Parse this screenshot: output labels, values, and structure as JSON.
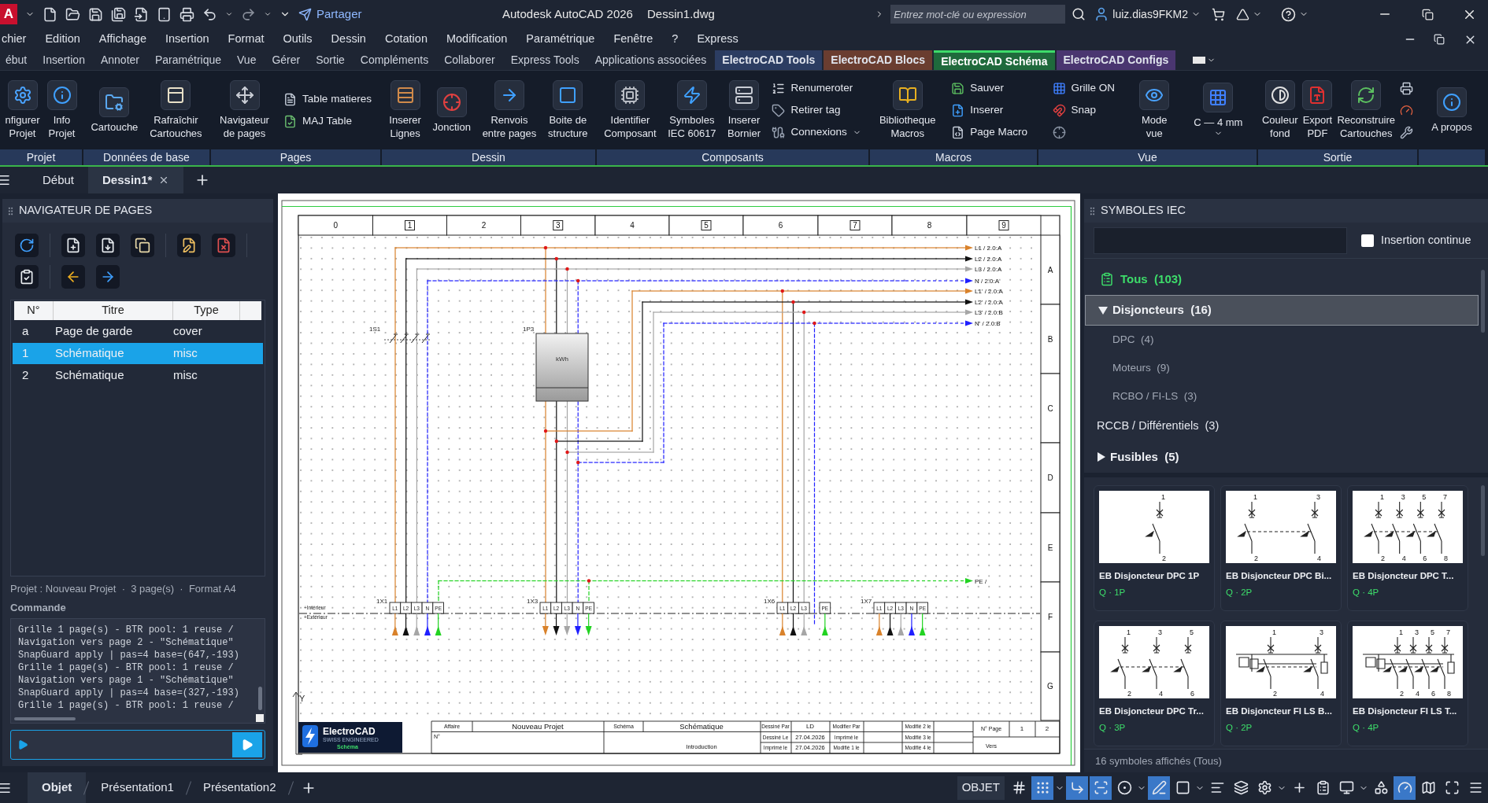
{
  "title_bar": {
    "logo": "A",
    "share": "Partager",
    "app_title": "Autodesk AutoCAD 2026",
    "file": "Dessin1.dwg",
    "search": {
      "placeholder": "Entrez mot-clé ou expression"
    },
    "user": "luiz.dias9FKM2"
  },
  "menu": [
    "chier",
    "Edition",
    "Affichage",
    "Insertion",
    "Format",
    "Outils",
    "Dessin",
    "Cotation",
    "Modification",
    "Paramétrique",
    "Fenêtre",
    "?",
    "Express"
  ],
  "ribbon_tabs": [
    {
      "label": "ébut",
      "selected": false
    },
    {
      "label": "Insertion",
      "selected": false
    },
    {
      "label": "Annoter",
      "selected": false
    },
    {
      "label": "Paramétrique",
      "selected": false
    },
    {
      "label": "Vue",
      "selected": false
    },
    {
      "label": "Gérer",
      "selected": false
    },
    {
      "label": "Sortie",
      "selected": false
    },
    {
      "label": "Compléments",
      "selected": false
    },
    {
      "label": "Collaborer",
      "selected": false
    },
    {
      "label": "Express Tools",
      "selected": false
    },
    {
      "label": "Applications associées",
      "selected": false
    },
    {
      "label": "ElectroCAD Tools",
      "selected": false,
      "color": "#2c3d62"
    },
    {
      "label": "ElectroCAD Blocs",
      "selected": false,
      "color": "#6a3d30"
    },
    {
      "label": "ElectroCAD Schéma",
      "selected": true,
      "color": "#1f6a3c"
    },
    {
      "label": "ElectroCAD Configs",
      "selected": false,
      "color": "#4a3670"
    }
  ],
  "ribbon": [
    {
      "label": "Projet",
      "items": [
        {
          "kind": "large",
          "lines": [
            "nfigurer",
            "Projet"
          ]
        },
        {
          "kind": "large",
          "lines": [
            "Info",
            "Projet"
          ]
        }
      ]
    },
    {
      "label": "Données de base",
      "items": [
        {
          "kind": "large",
          "lines": [
            "Cartouche"
          ]
        },
        {
          "kind": "large",
          "lines": [
            "Rafraîchir",
            "Cartouches"
          ]
        }
      ]
    },
    {
      "label": "Pages",
      "items": [
        {
          "kind": "large",
          "lines": [
            "Navigateur",
            "de pages"
          ]
        },
        {
          "kind": "small",
          "label": "Table matieres"
        },
        {
          "kind": "small",
          "label": "MAJ Table"
        }
      ]
    },
    {
      "label": "Dessin",
      "items": [
        {
          "kind": "large",
          "lines": [
            "Inserer",
            "Lignes"
          ]
        },
        {
          "kind": "large",
          "lines": [
            "Jonction"
          ]
        },
        {
          "kind": "large",
          "lines": [
            "Renvois",
            "entre pages"
          ]
        },
        {
          "kind": "large",
          "lines": [
            "Boite de",
            "structure"
          ]
        }
      ]
    },
    {
      "label": "Composants",
      "items": [
        {
          "kind": "large",
          "lines": [
            "Identifier",
            "Composant"
          ]
        },
        {
          "kind": "large",
          "lines": [
            "Symboles",
            "IEC 60617"
          ]
        },
        {
          "kind": "large",
          "lines": [
            "Inserer",
            "Bornier"
          ]
        },
        {
          "kind": "small",
          "label": "Renumeroter"
        },
        {
          "kind": "small",
          "label": "Retirer tag"
        },
        {
          "kind": "small",
          "label": "Connexions",
          "dropdown": true
        }
      ]
    },
    {
      "label": "Macros",
      "items": [
        {
          "kind": "large",
          "lines": [
            "Bibliotheque",
            "Macros"
          ]
        },
        {
          "kind": "small",
          "label": "Sauver"
        },
        {
          "kind": "small",
          "label": "Inserer"
        },
        {
          "kind": "small",
          "label": "Page Macro"
        }
      ]
    },
    {
      "label": "Vue",
      "items": [
        {
          "kind": "small",
          "label": "Grille ON"
        },
        {
          "kind": "small",
          "label": "Snap"
        },
        {
          "kind": "small"
        },
        {
          "kind": "large",
          "lines": [
            "Mode",
            "vue"
          ]
        },
        {
          "kind": "large",
          "lines": [
            "C — 4 mm"
          ],
          "dropdown": true
        }
      ]
    },
    {
      "label": "Sortie",
      "items": [
        {
          "kind": "large",
          "lines": [
            "Couleur",
            "fond"
          ]
        },
        {
          "kind": "large",
          "lines": [
            "Export",
            "PDF"
          ]
        },
        {
          "kind": "large",
          "lines": [
            "Reconstruire",
            "Cartouches"
          ]
        },
        {
          "kind": "small"
        },
        {
          "kind": "small"
        },
        {
          "kind": "small"
        }
      ]
    },
    {
      "items": [
        {
          "kind": "large",
          "lines": [
            "A propos"
          ]
        }
      ]
    }
  ],
  "doc_tabs": [
    {
      "label": "Début",
      "selected": false,
      "closable": false
    },
    {
      "label": "Dessin1*",
      "selected": true,
      "closable": true
    }
  ],
  "page_navigator": {
    "title": "NAVIGATEUR DE PAGES",
    "columns": [
      "N°",
      "Titre",
      "Type"
    ],
    "rows": [
      {
        "no": "a",
        "title": "Page de garde",
        "type": "cover",
        "selected": false
      },
      {
        "no": "1",
        "title": "Schématique",
        "type": "misc",
        "selected": true
      },
      {
        "no": "2",
        "title": "Schématique",
        "type": "misc",
        "selected": false
      }
    ],
    "summary": "Projet : Nouveau Projet  ·  3 page(s)  ·  Format A4",
    "command_label": "Commande",
    "log": [
      "Grille 1 page(s) - BTR pool: 1 reuse /",
      "Navigation vers page 2 - \"Schématique\"",
      "SnapGuard apply | pas=4 base=(647,-193)",
      "Grille 1 page(s) - BTR pool: 1 reuse /",
      "Navigation vers page 1 - \"Schématique\"",
      "SnapGuard apply | pas=4 base=(327,-193)",
      "Grille 1 page(s) - BTR pool: 1 reuse /"
    ]
  },
  "drawing": {
    "columns": [
      {
        "label": "0",
        "boxed": false
      },
      {
        "label": "1",
        "boxed": true
      },
      {
        "label": "2",
        "boxed": false
      },
      {
        "label": "3",
        "boxed": true
      },
      {
        "label": "4",
        "boxed": false
      },
      {
        "label": "5",
        "boxed": true
      },
      {
        "label": "6",
        "boxed": false
      },
      {
        "label": "7",
        "boxed": true
      },
      {
        "label": "8",
        "boxed": false
      },
      {
        "label": "9",
        "boxed": true
      }
    ],
    "rows": [
      "A",
      "B",
      "C",
      "D",
      "E",
      "F",
      "G"
    ],
    "nets": [
      {
        "label": "L1 / 2.0:A",
        "color": "#d9822b",
        "dashed": false
      },
      {
        "label": "L2 / 2.0:A",
        "color": "#111111",
        "dashed": false
      },
      {
        "label": "L3 / 2.0:A",
        "color": "#a6a6a6",
        "dashed": false
      },
      {
        "label": "N / 2.0:A",
        "color": "#1f1fff",
        "dashed": true
      },
      {
        "label": "L1' / 2.0:A",
        "color": "#d9822b",
        "dashed": false
      },
      {
        "label": "L2' / 2.0:A",
        "color": "#111111",
        "dashed": false
      },
      {
        "label": "L3' / 2.0:B",
        "color": "#a6a6a6",
        "dashed": false
      },
      {
        "label": "N' / 2.0:B",
        "color": "#1f1fff",
        "dashed": true
      },
      {
        "label": "PE /",
        "color": "#22d322",
        "dashed": true
      }
    ],
    "switch": {
      "tag": "1S1"
    },
    "meter": {
      "tag": "1P3",
      "unit": "kWh"
    },
    "terminal_blocks": [
      {
        "tag": "1X1",
        "arrows_down": false,
        "terminals": [
          {
            "label": "L1",
            "color": "#d9822b"
          },
          {
            "label": "L2",
            "color": "#111111"
          },
          {
            "label": "L3",
            "color": "#a6a6a6"
          },
          {
            "label": "N",
            "color": "#1f1fff"
          },
          {
            "label": "PE",
            "color": "#22d322"
          }
        ]
      },
      {
        "tag": "1X3",
        "arrows_down": true,
        "terminals": [
          {
            "label": "L1",
            "color": "#d9822b"
          },
          {
            "label": "L2",
            "color": "#111111"
          },
          {
            "label": "L3",
            "color": "#a6a6a6"
          },
          {
            "label": "N",
            "color": "#1f1fff"
          },
          {
            "label": "PE",
            "color": "#22d322"
          }
        ]
      },
      {
        "tag": "1X6",
        "arrows_down": false,
        "terminals": [
          {
            "label": "L1",
            "color": "#d9822b"
          },
          {
            "label": "L2",
            "color": "#111111"
          },
          {
            "label": "L3",
            "color": "#a6a6a6"
          },
          {
            "label": "PE",
            "color": "#22d322"
          }
        ]
      },
      {
        "tag": "1X7",
        "arrows_down": false,
        "terminals": [
          {
            "label": "L1",
            "color": "#d9822b"
          },
          {
            "label": "L2",
            "color": "#111111"
          },
          {
            "label": "L3",
            "color": "#a6a6a6"
          },
          {
            "label": "N",
            "color": "#1f1fff"
          },
          {
            "label": "PE",
            "color": "#22d322"
          }
        ]
      }
    ],
    "zones": [
      "+Intérieur",
      "+Extérieur"
    ],
    "ucs": "Y",
    "logo": {
      "name": "ElectroCAD",
      "tagline": "SWISS ENGINEERED",
      "sub": "Schéma"
    },
    "title_block": [
      "Affaire",
      "N°",
      "Nouveau Projet",
      "Schéma",
      "Schématique",
      "Introduction",
      "Dessiné Par",
      "LD",
      "Modifier Par",
      "Modifié 2 le",
      "Dessiné Le",
      "27.04.2026",
      "Imprimé le",
      "Modifié 3 le",
      "Imprimé le",
      "27.04.2026",
      "Modifié 1 le",
      "Modifié 4 le",
      "N° Page",
      "1",
      "2",
      "Vers"
    ]
  },
  "symbols": {
    "title": "SYMBOLES IEC",
    "continuous_insert": {
      "label": "Insertion continue",
      "checked": false
    },
    "tree": [
      {
        "kind": "all",
        "label": "Tous  (103)"
      },
      {
        "kind": "folder",
        "label": "Disjoncteurs  (16)",
        "expanded": true,
        "selected": true,
        "children": [
          {
            "label": "DPC  (4)"
          },
          {
            "label": "Moteurs  (9)"
          },
          {
            "label": "RCBO / FI-LS  (3)"
          }
        ]
      },
      {
        "kind": "leaf",
        "label": "RCCB / Différentiels  (3)"
      },
      {
        "kind": "folder",
        "label": "Fusibles  (5)",
        "expanded": false,
        "selected": false
      }
    ],
    "cards": [
      {
        "kind": "mcb",
        "title": "EB Disjoncteur DPC 1P",
        "meta": "Q · 1P",
        "top_pins": [
          "1"
        ],
        "bottom_pins": [
          "2"
        ]
      },
      {
        "kind": "mcb",
        "title": "EB Disjoncteur DPC Bi...",
        "meta": "Q · 2P",
        "top_pins": [
          "1",
          "3"
        ],
        "bottom_pins": [
          "2",
          "4"
        ]
      },
      {
        "kind": "mcb",
        "title": "EB Disjoncteur DPC T...",
        "meta": "Q · 4P",
        "top_pins": [
          "1",
          "3",
          "5",
          "7"
        ],
        "bottom_pins": [
          "2",
          "4",
          "6",
          "8"
        ]
      },
      {
        "kind": "mcb",
        "title": "EB Disjoncteur DPC Tr...",
        "meta": "Q · 3P",
        "top_pins": [
          "1",
          "3",
          "5"
        ],
        "bottom_pins": [
          "2",
          "4",
          "6"
        ]
      },
      {
        "kind": "rcbo",
        "title": "EB Disjoncteur FI LS B...",
        "meta": "Q · 2P",
        "top_pins": [
          "1",
          "3"
        ],
        "bottom_pins": [
          "2",
          "4"
        ]
      },
      {
        "kind": "rcbo",
        "title": "EB Disjoncteur FI LS T...",
        "meta": "Q · 4P",
        "top_pins": [
          "1",
          "3",
          "5",
          "7"
        ],
        "bottom_pins": [
          "2",
          "4",
          "6",
          "8"
        ]
      }
    ],
    "footer": "16 symboles affichés (Tous)"
  },
  "status_bar": {
    "layouts": [
      {
        "label": "Objet",
        "selected": true
      },
      {
        "label": "Présentation1",
        "selected": false
      },
      {
        "label": "Présentation2",
        "selected": false
      }
    ],
    "mode": "OBJET",
    "tools": [
      {
        "on": false
      },
      {
        "on": true,
        "dropdown": true
      },
      {
        "on": true
      },
      {
        "on": true
      },
      {
        "on": false,
        "dropdown": true
      },
      {
        "on": true
      },
      {
        "on": false,
        "dropdown": true
      },
      {
        "on": false
      },
      {
        "on": false
      },
      {
        "on": false,
        "dropdown": true
      },
      {
        "on": false
      },
      {
        "on": false
      },
      {
        "on": false,
        "dropdown": true
      },
      {
        "on": false
      },
      {
        "on": true
      },
      {
        "on": false
      },
      {
        "on": false
      },
      {
        "on": false
      }
    ]
  }
}
